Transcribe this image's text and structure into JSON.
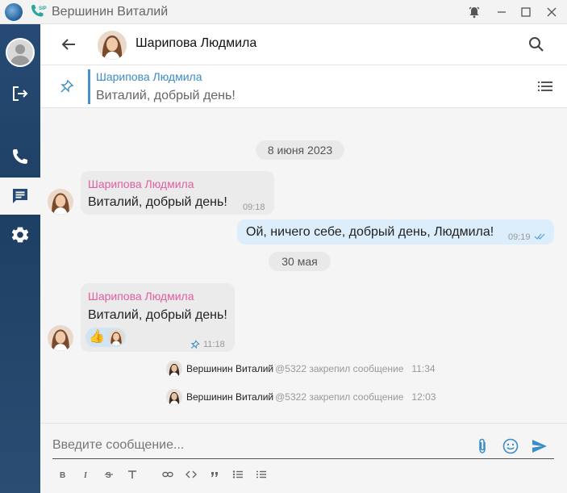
{
  "window": {
    "title": "Вершинин Виталий",
    "sip_badge": "SIP"
  },
  "sidebar": {
    "items": [
      {
        "name": "profile",
        "icon": "user-avatar-icon"
      },
      {
        "name": "logout",
        "icon": "logout-icon"
      },
      {
        "name": "calls",
        "icon": "phone-icon"
      },
      {
        "name": "chats",
        "icon": "chat-icon",
        "active": true
      },
      {
        "name": "settings",
        "icon": "gear-icon"
      }
    ]
  },
  "header": {
    "contact_name": "Шарипова Людмила"
  },
  "pinned": {
    "author": "Шарипова Людмила",
    "text": "Виталий, добрый день!"
  },
  "messages": {
    "date1": "8 июня 2023",
    "m1": {
      "author": "Шарипова Людмила",
      "text": "Виталий, добрый день!",
      "time": "09:18"
    },
    "m2": {
      "text": "Ой, ничего себе, добрый день, Людмила!",
      "time": "09:19"
    },
    "date2": "30 мая",
    "m3": {
      "author": "Шарипова Людмила",
      "text": "Виталий, добрый день!",
      "time": "11:18",
      "reaction": "👍"
    },
    "sys1": {
      "who": "Вершинин Виталий",
      "action": "@5322 закрепил сообщение",
      "time": "11:34"
    },
    "sys2": {
      "who": "Вершинин Виталий",
      "action": "@5322 закрепил сообщение",
      "time": "12:03"
    }
  },
  "composer": {
    "placeholder": "Введите сообщение...",
    "format_buttons": [
      "B",
      "I",
      "S",
      "T",
      "link",
      "code",
      "quote",
      "bullet-list",
      "numbered-list"
    ]
  },
  "colors": {
    "accent": "#3b8dc4",
    "author_pink": "#e05fa0",
    "outgoing_bubble": "#dceefb",
    "incoming_bubble": "#ebebeb",
    "sidebar": "#274b75"
  }
}
